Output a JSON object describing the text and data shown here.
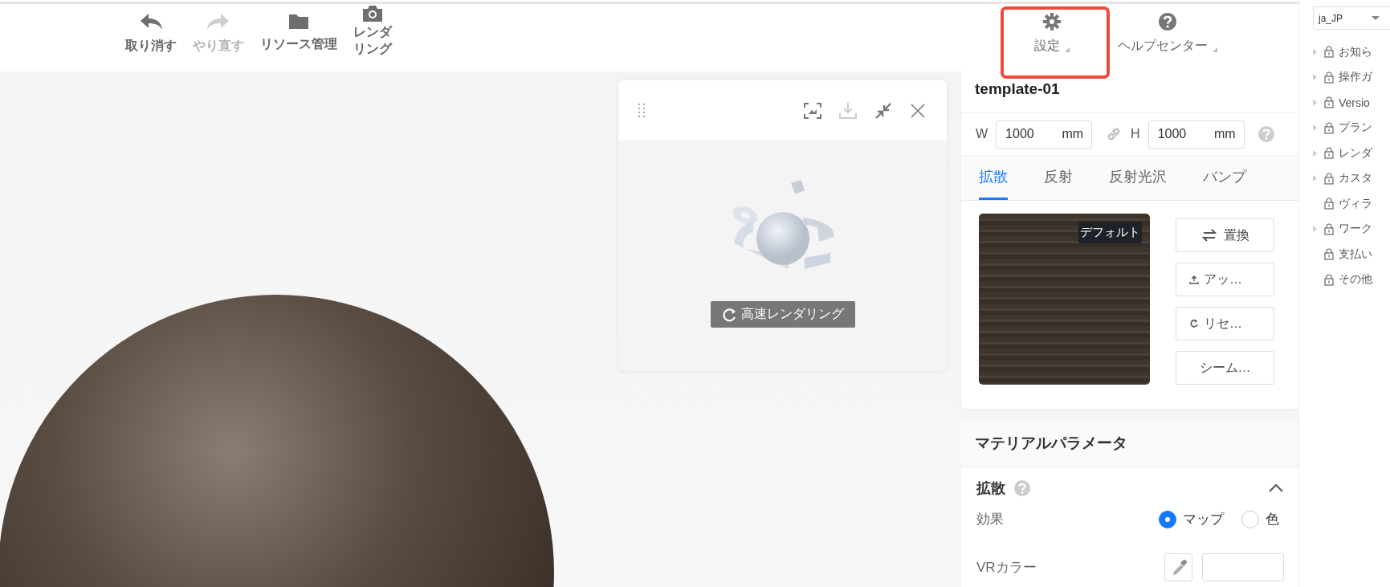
{
  "toolbar": {
    "left_items": [
      {
        "kind": "undo",
        "label": "取り消す",
        "disabled": false
      },
      {
        "kind": "redo",
        "label": "やり直す",
        "disabled": true
      },
      {
        "kind": "folder",
        "label": "リソース管理",
        "disabled": false
      },
      {
        "kind": "camera",
        "label": "レンダリング",
        "disabled": false
      }
    ],
    "right_items": [
      {
        "kind": "settings",
        "label": "設定",
        "highlighted": true
      },
      {
        "kind": "help",
        "label": "ヘルプセンター",
        "highlighted": false
      }
    ]
  },
  "render_panel": {
    "button": "高速レンダリング"
  },
  "material_card": {
    "title": "template-01",
    "width": {
      "label": "W",
      "value": "1000",
      "unit": "mm"
    },
    "height": {
      "label": "H",
      "value": "1000",
      "unit": "mm"
    },
    "tabs": [
      {
        "label": "拡散",
        "selected": true
      },
      {
        "label": "反射",
        "selected": false
      },
      {
        "label": "反射光沢",
        "selected": false
      },
      {
        "label": "バンプ",
        "selected": false
      }
    ],
    "texture": {
      "badge": "デフォルト"
    },
    "actions": [
      {
        "kind": "replace",
        "label": "置換"
      },
      {
        "kind": "upload",
        "label": "アッ…"
      },
      {
        "kind": "reset",
        "label": "リセ…"
      },
      {
        "kind": "plain",
        "label": "シーム…"
      }
    ]
  },
  "params_card": {
    "title": "マテリアルパラメータ",
    "section": {
      "title": "拡散",
      "expanded": true,
      "effect": {
        "label": "効果",
        "options": [
          {
            "label": "マップ",
            "selected": true
          },
          {
            "label": "色",
            "selected": false
          }
        ]
      },
      "vr_color": {
        "label": "VRカラー"
      }
    }
  },
  "sidebar": {
    "language": "ja_JP",
    "items": [
      {
        "label": "お知ら",
        "expandable": true
      },
      {
        "label": "操作ガ",
        "expandable": true
      },
      {
        "label": "Versio",
        "expandable": true
      },
      {
        "label": "プラン",
        "expandable": true
      },
      {
        "label": "レンダ",
        "expandable": true
      },
      {
        "label": "カスタ",
        "expandable": true
      },
      {
        "label": "ヴィラ",
        "expandable": false
      },
      {
        "label": "ワーク",
        "expandable": true
      },
      {
        "label": "支払い",
        "expandable": false
      },
      {
        "label": "その他",
        "expandable": false
      }
    ]
  }
}
